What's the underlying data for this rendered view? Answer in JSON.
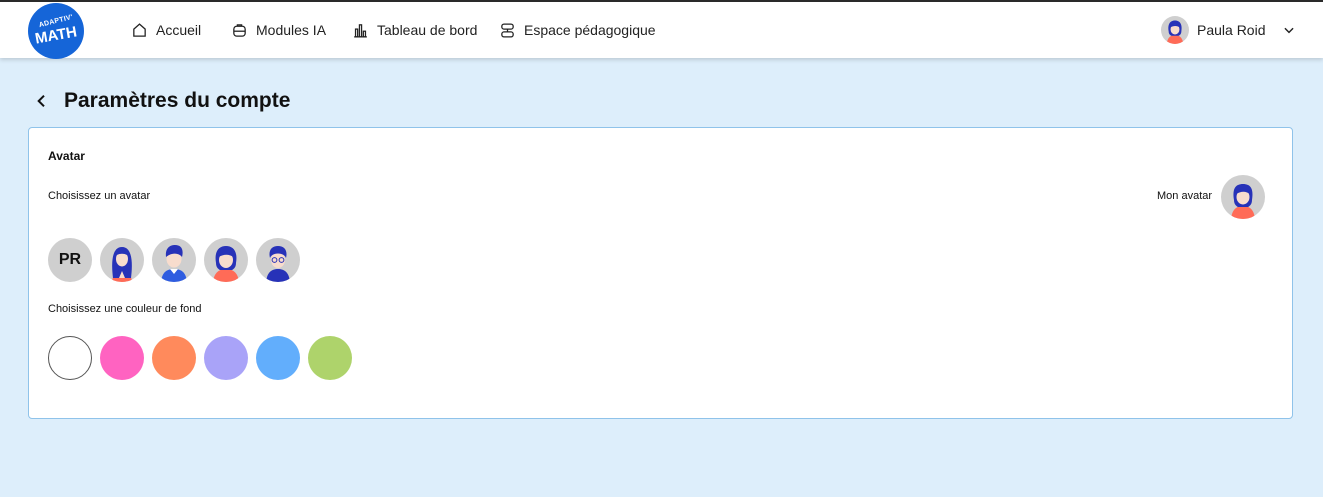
{
  "logo": {
    "line1": "ADAPTIV'",
    "line2": "MATH"
  },
  "nav": {
    "items": [
      {
        "label": "Accueil"
      },
      {
        "label": "Modules IA"
      },
      {
        "label": "Tableau de bord"
      },
      {
        "label": "Espace pédagogique"
      }
    ]
  },
  "user": {
    "name": "Paula Roid"
  },
  "page": {
    "title": "Paramètres du compte"
  },
  "avatar_section": {
    "title": "Avatar",
    "choose_label": "Choisissez un avatar",
    "current_label": "Mon avatar",
    "initials": "PR",
    "color_label": "Choisissez une couleur de fond"
  },
  "colors": {
    "brand": "#1565d8",
    "background_options": [
      "#ffffff",
      "#ff63c1",
      "#ff8a5c",
      "#a9a3f8",
      "#62aefc",
      "#aed36b"
    ]
  }
}
